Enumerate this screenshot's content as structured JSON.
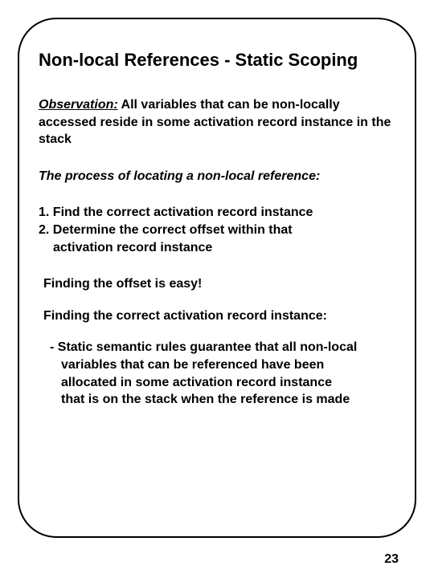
{
  "title": "Non-local References - Static Scoping",
  "observation": {
    "label": "Observation:",
    "text": " All variables that can be non-locally accessed reside in some activation record instance in the stack"
  },
  "process": {
    "label": "The process of locating a non-local reference:"
  },
  "steps": {
    "s1": "1. Find the correct activation record instance",
    "s2a": "2. Determine the correct offset within that",
    "s2b": "activation record instance"
  },
  "offset_easy": "Finding the offset is easy!",
  "finding_ari": "Finding the correct activation record instance:",
  "rule": {
    "l1": "- Static semantic rules guarantee that all non-local",
    "l2": "variables that can be referenced have been",
    "l3": "allocated in some activation record instance",
    "l4": "that is on the stack when the reference is made"
  },
  "page_number": "23"
}
